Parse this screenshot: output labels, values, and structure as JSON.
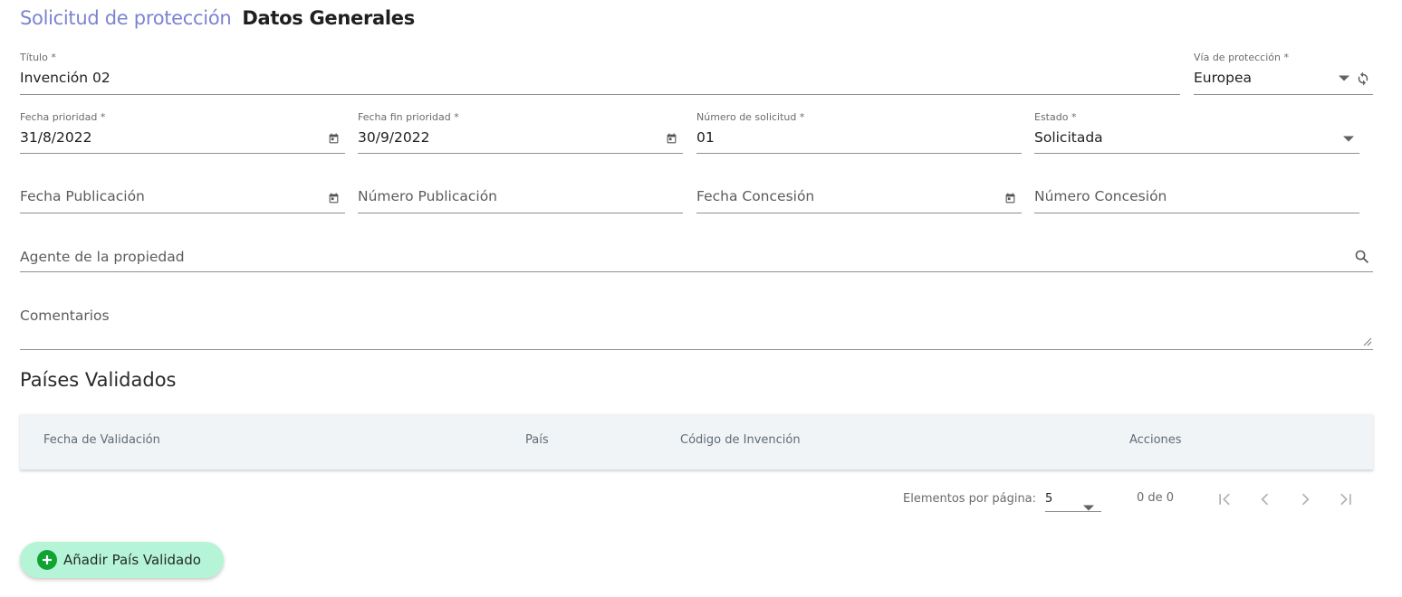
{
  "header": {
    "breadcrumb": "Solicitud de protección",
    "title": "Datos Generales"
  },
  "form": {
    "titulo": {
      "label": "Título *",
      "value": "Invención 02"
    },
    "via": {
      "label": "Vía de protección *",
      "value": "Europea"
    },
    "fecha_prioridad": {
      "label": "Fecha prioridad *",
      "value": "31/8/2022"
    },
    "fecha_fin_prioridad": {
      "label": "Fecha fin prioridad *",
      "value": "30/9/2022"
    },
    "numero_solicitud": {
      "label": "Número de solicitud *",
      "value": "01"
    },
    "estado": {
      "label": "Estado *",
      "value": "Solicitada"
    },
    "fecha_publicacion": {
      "placeholder": "Fecha Publicación"
    },
    "numero_publicacion": {
      "placeholder": "Número Publicación"
    },
    "fecha_concesion": {
      "placeholder": "Fecha Concesión"
    },
    "numero_concesion": {
      "placeholder": "Número Concesión"
    },
    "agente": {
      "placeholder": "Agente de la propiedad"
    },
    "comentarios": {
      "placeholder": "Comentarios"
    }
  },
  "validated_countries": {
    "section_title": "Países Validados",
    "columns": [
      "Fecha de Validación",
      "País",
      "Código de Invención",
      "Acciones"
    ],
    "rows": []
  },
  "paginator": {
    "items_per_page_label": "Elementos por página:",
    "items_per_page": "5",
    "range": "0 de 0"
  },
  "actions": {
    "add_country": "Añadir País Validado"
  },
  "colors": {
    "accent": "#7c83d1",
    "add_button_bg": "#b6f4d7",
    "add_icon": "#10a334",
    "table_header_bg": "#f1f4f7"
  },
  "icons": {
    "date": "calendar-icon",
    "dropdown": "chevron-down-icon",
    "refresh": "refresh-icon",
    "search": "search-icon",
    "add": "plus-circle-icon"
  }
}
